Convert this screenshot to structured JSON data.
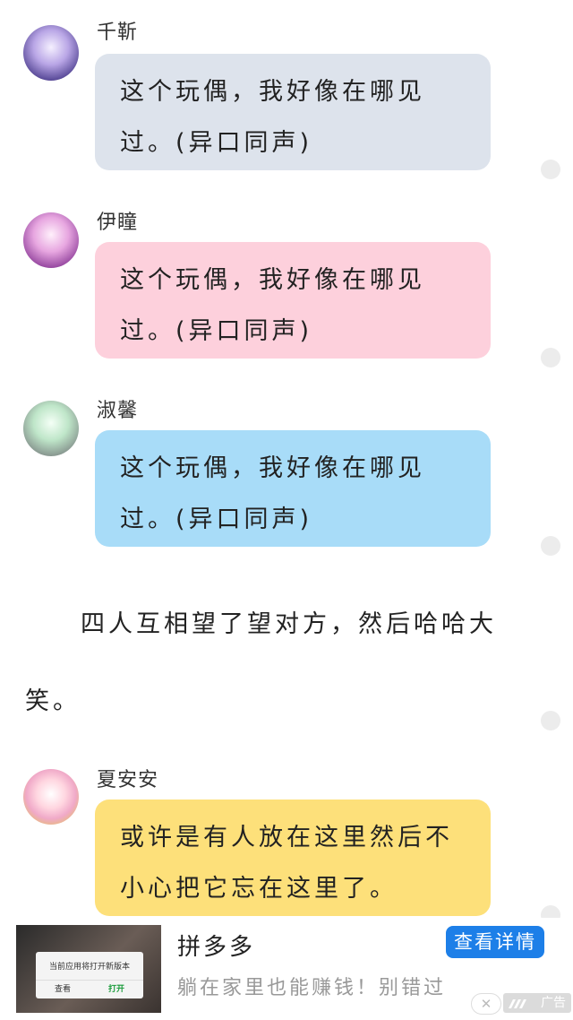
{
  "messages": [
    {
      "name": "千靳",
      "line1": "这个玩偶，我好像在哪见",
      "line2": "过。(异口同声)",
      "color": "#dde3ec"
    },
    {
      "name": "伊瞳",
      "line1": "这个玩偶，我好像在哪见",
      "line2": "过。(异口同声)",
      "color": "#fdd0dc"
    },
    {
      "name": "淑馨",
      "line1": "这个玩偶，我好像在哪见",
      "line2": "过。(异口同声)",
      "color": "#a8dcf8"
    },
    {
      "name": "夏安安",
      "line1": "或许是有人放在这里然后不",
      "line2": "小心把它忘在这里了。",
      "color": "#fde07a"
    }
  ],
  "narration": {
    "line1": "四人互相望了望对方，然后哈哈大",
    "line2": "笑。"
  },
  "ad": {
    "title": "拼多多",
    "description": "躺在家里也能赚钱！别错过",
    "button_label": "查看详情",
    "badge_label": "广告",
    "thumb_dialog_text": "当前应用将打开新版本",
    "thumb_dialog_cancel": "查看",
    "thumb_dialog_ok": "打开",
    "button_color": "#1d7fe8"
  }
}
